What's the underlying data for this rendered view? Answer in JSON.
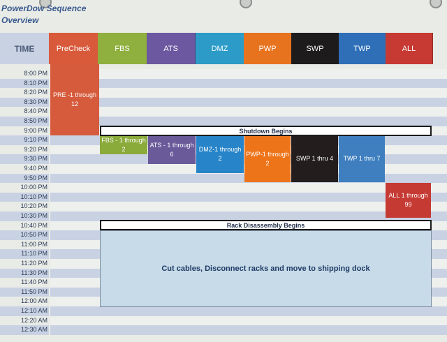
{
  "doc_title": {
    "line1": "PowerDow  Sequence",
    "line2": "Overview"
  },
  "header": {
    "time_label": "TIME",
    "columns": [
      {
        "label": "PreCheck",
        "color": "#d85a3a"
      },
      {
        "label": "FBS",
        "color": "#8faf3e"
      },
      {
        "label": "ATS",
        "color": "#6b58a0"
      },
      {
        "label": "DMZ",
        "color": "#2c9bc7"
      },
      {
        "label": "PWP",
        "color": "#e8731f"
      },
      {
        "label": "SWP",
        "color": "#1e1b1c"
      },
      {
        "label": "TWP",
        "color": "#2e6fb8"
      },
      {
        "label": "ALL",
        "color": "#c63a33"
      }
    ]
  },
  "times": [
    "8:00 PM",
    "8:10 PM",
    "8:20 PM",
    "8:30 PM",
    "8:40 PM",
    "8:50 PM",
    "9:00 PM",
    "9:10 PM",
    "9:20 PM",
    "9:30 PM",
    "9:40 PM",
    "9:50 PM",
    "10:00 PM",
    "10:10 PM",
    "10:20 PM",
    "10:30 PM",
    "10:40 PM",
    "10:50 PM",
    "11:00 PM",
    "11:10 PM",
    "11:20 PM",
    "11:30 PM",
    "11:40 PM",
    "11:50 PM",
    "12:00 AM",
    "12:10 AM",
    "12:20 AM",
    "12:30 AM"
  ],
  "blocks": {
    "pre": "PRE -1 through 12",
    "fbs": "FBS - 1 through 2",
    "ats": "ATS - 1 through 6",
    "dmz": "DMZ-1 through 2",
    "pwp": "PWP-1 through 2",
    "swp": "SWP 1 thru 4",
    "twp": "TWP 1 thru 7",
    "all": "ALL 1 through 99"
  },
  "banners": {
    "shutdown": "Shutdown Begins",
    "rack": "Rack Disassembly Begins"
  },
  "main_task": "Cut cables, Disconnect racks and move to shipping dock"
}
